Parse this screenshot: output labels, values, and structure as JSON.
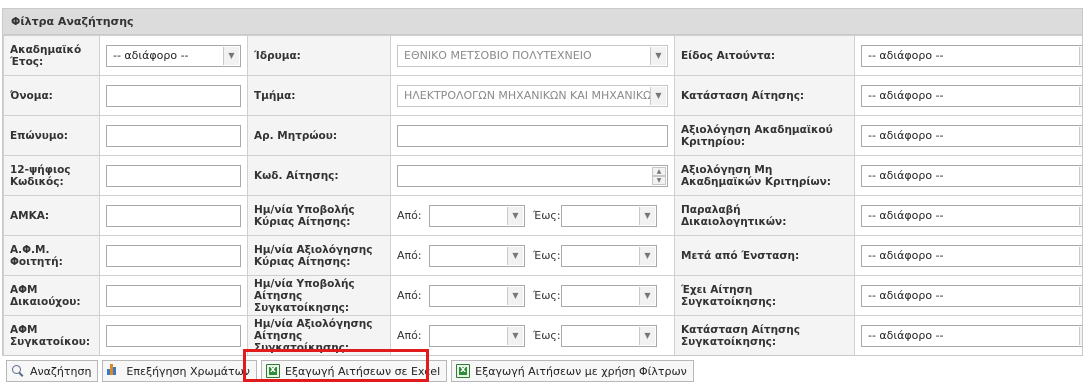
{
  "panel": {
    "title": "Φίλτρα Αναζήτησης"
  },
  "filters": {
    "academic_year": {
      "label": "Ακαδημαϊκό Έτος:",
      "value": "-- αδιάφορο --"
    },
    "institution": {
      "label": "Ίδρυμα:",
      "value": "ΕΘΝΙΚΟ ΜΕΤΣΟΒΙΟ ΠΟΛΥΤΕΧΝΕΙΟ"
    },
    "applicant_type": {
      "label": "Είδος Αιτούντα:",
      "value": "-- αδιάφορο --"
    },
    "first_name": {
      "label": "Όνομα:"
    },
    "department": {
      "label": "Τμήμα:",
      "value": "ΗΛΕΚΤΡΟΛΟΓΩΝ ΜΗΧΑΝΙΚΩΝ ΚΑΙ ΜΗΧΑΝΙΚΩΝ"
    },
    "application_status": {
      "label": "Κατάσταση Αίτησης:",
      "value": "-- αδιάφορο --"
    },
    "last_name": {
      "label": "Επώνυμο:"
    },
    "registry_number": {
      "label": "Αρ. Μητρώου:"
    },
    "academic_eval": {
      "label": "Αξιολόγηση Ακαδημαϊκού Κριτηρίου:",
      "value": "-- αδιάφορο --"
    },
    "code12": {
      "label": "12-ψήφιος Κωδικός:"
    },
    "application_code": {
      "label": "Κωδ. Αίτησης:"
    },
    "non_academic_eval": {
      "label": "Αξιολόγηση Μη Ακαδημαϊκών Κριτηρίων:",
      "value": "-- αδιάφορο --"
    },
    "amka": {
      "label": "ΑΜΚΑ:"
    },
    "main_submission_date": {
      "label": "Ημ/νία Υποβολής Κύριας Αίτησης:"
    },
    "documents_received": {
      "label": "Παραλαβή Δικαιολογητικών:",
      "value": "-- αδιάφορο --"
    },
    "student_afm": {
      "label": "Α.Φ.Μ. Φοιτητή:"
    },
    "main_eval_date": {
      "label": "Ημ/νία Αξιολόγησης Κύριας Αίτησης:"
    },
    "after_objection": {
      "label": "Μετά από Ένσταση:",
      "value": "-- αδιάφορο --"
    },
    "beneficiary_afm": {
      "label": "ΑΦΜ Δικαιούχου:"
    },
    "cohab_submission_date": {
      "label": "Ημ/νία Υποβολής Αίτησης Συγκατοίκησης:"
    },
    "has_cohab": {
      "label": "Έχει Αίτηση Συγκατοίκησης:",
      "value": "-- αδιάφορο --"
    },
    "roommate_afm": {
      "label": "ΑΦΜ Συγκατοίκου:"
    },
    "cohab_eval_date": {
      "label": "Ημ/νία Αξιολόγησης Αίτησης Συγκατοίκησης:"
    },
    "cohab_status": {
      "label": "Κατάσταση Αίτησης Συγκατοίκησης:",
      "value": "-- αδιάφορο --"
    }
  },
  "range": {
    "from_label": "Από:",
    "to_label": "Έως:"
  },
  "buttons": {
    "search": "Αναζήτηση",
    "color_legend": "Επεξήγηση Χρωμάτων",
    "export_excel": "Εξαγωγή Αιτήσεων σε Excel",
    "export_filtered": "Εξαγωγή Αιτήσεων με χρήση Φίλτρων"
  },
  "colors": {
    "highlight": "#e01b1b",
    "header_bg": "#dcdcdc",
    "label_bg": "#f4f4f4"
  }
}
